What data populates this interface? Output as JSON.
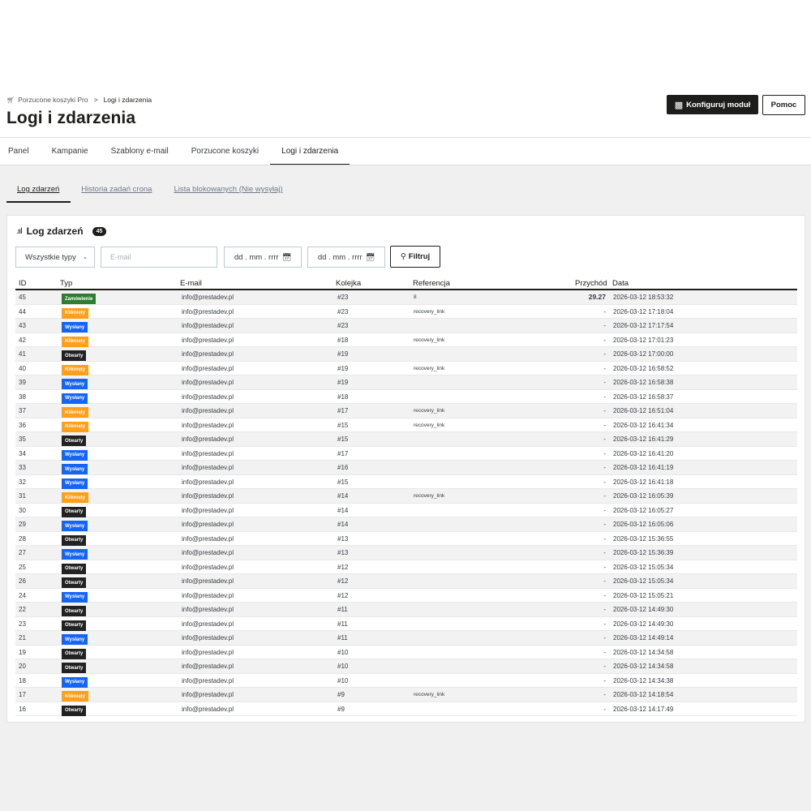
{
  "colors": {
    "zamowienie": "#2e7d32",
    "klikniety": "#ff9f1a",
    "wyslany": "#1565f5",
    "otwarty": "#222222",
    "primary": "#1d1d1b"
  },
  "breadcrumb": {
    "icon": "cart-icon",
    "parent": "Porzucone koszyki Pro",
    "separator": ">",
    "current": "Logi i zdarzenia"
  },
  "page_title": "Logi i zdarzenia",
  "header_buttons": {
    "configure": "Konfiguruj moduł",
    "help": "Pomoc"
  },
  "tabs": [
    "Panel",
    "Kampanie",
    "Szablony e-mail",
    "Porzucone koszyki",
    "Logi i zdarzenia"
  ],
  "active_tab": "Logi i zdarzenia",
  "subtabs": [
    "Log zdarzeń",
    "Historia zadań crona",
    "Lista blokowanych (Nie wysyłaj)"
  ],
  "card": {
    "title": "Log zdarzeń",
    "count": "45"
  },
  "filters": {
    "type_select": "Wszystkie typy",
    "email_placeholder": "E-mail",
    "date_from": "dd . mm . rrrr",
    "date_to": "dd . mm . rrrr",
    "filter_button": "Filtruj"
  },
  "columns": {
    "id": "ID",
    "typ": "Typ",
    "email": "E-mail",
    "kolejka": "Kolejka",
    "referencja": "Referencja",
    "przychod": "Przychód",
    "data": "Data"
  },
  "rows": [
    {
      "id": "45",
      "type": "Zamówienie",
      "kind": "zamowienie",
      "email": "info@prestadev.pl",
      "queue": "#23",
      "ref": "8",
      "revenue": "29.27",
      "date": "2026-03-12 18:53:32"
    },
    {
      "id": "44",
      "type": "Kliknięty",
      "kind": "klikniety",
      "email": "info@prestadev.pl",
      "queue": "#23",
      "ref": "recovery_link",
      "revenue": "-",
      "date": "2026-03-12 17:18:04"
    },
    {
      "id": "43",
      "type": "Wysłany",
      "kind": "wyslany",
      "email": "info@prestadev.pl",
      "queue": "#23",
      "ref": "",
      "revenue": "-",
      "date": "2026-03-12 17:17:54"
    },
    {
      "id": "42",
      "type": "Kliknięty",
      "kind": "klikniety",
      "email": "info@prestadev.pl",
      "queue": "#18",
      "ref": "recovery_link",
      "revenue": "-",
      "date": "2026-03-12 17:01:23"
    },
    {
      "id": "41",
      "type": "Otwarty",
      "kind": "otwarty",
      "email": "info@prestadev.pl",
      "queue": "#19",
      "ref": "",
      "revenue": "-",
      "date": "2026-03-12 17:00:00"
    },
    {
      "id": "40",
      "type": "Kliknięty",
      "kind": "klikniety",
      "email": "info@prestadev.pl",
      "queue": "#19",
      "ref": "recovery_link",
      "revenue": "-",
      "date": "2026-03-12 16:58:52"
    },
    {
      "id": "39",
      "type": "Wysłany",
      "kind": "wyslany",
      "email": "info@prestadev.pl",
      "queue": "#19",
      "ref": "",
      "revenue": "-",
      "date": "2026-03-12 16:58:38"
    },
    {
      "id": "38",
      "type": "Wysłany",
      "kind": "wyslany",
      "email": "info@prestadev.pl",
      "queue": "#18",
      "ref": "",
      "revenue": "-",
      "date": "2026-03-12 16:58:37"
    },
    {
      "id": "37",
      "type": "Kliknięty",
      "kind": "klikniety",
      "email": "info@prestadev.pl",
      "queue": "#17",
      "ref": "recovery_link",
      "revenue": "-",
      "date": "2026-03-12 16:51:04"
    },
    {
      "id": "36",
      "type": "Kliknięty",
      "kind": "klikniety",
      "email": "info@prestadev.pl",
      "queue": "#15",
      "ref": "recovery_link",
      "revenue": "-",
      "date": "2026-03-12 16:41:34"
    },
    {
      "id": "35",
      "type": "Otwarty",
      "kind": "otwarty",
      "email": "info@prestadev.pl",
      "queue": "#15",
      "ref": "",
      "revenue": "-",
      "date": "2026-03-12 16:41:29"
    },
    {
      "id": "34",
      "type": "Wysłany",
      "kind": "wyslany",
      "email": "info@prestadev.pl",
      "queue": "#17",
      "ref": "",
      "revenue": "-",
      "date": "2026-03-12 16:41:20"
    },
    {
      "id": "33",
      "type": "Wysłany",
      "kind": "wyslany",
      "email": "info@prestadev.pl",
      "queue": "#16",
      "ref": "",
      "revenue": "-",
      "date": "2026-03-12 16:41:19"
    },
    {
      "id": "32",
      "type": "Wysłany",
      "kind": "wyslany",
      "email": "info@prestadev.pl",
      "queue": "#15",
      "ref": "",
      "revenue": "-",
      "date": "2026-03-12 16:41:18"
    },
    {
      "id": "31",
      "type": "Kliknięty",
      "kind": "klikniety",
      "email": "info@prestadev.pl",
      "queue": "#14",
      "ref": "recovery_link",
      "revenue": "-",
      "date": "2026-03-12 16:05:39"
    },
    {
      "id": "30",
      "type": "Otwarty",
      "kind": "otwarty",
      "email": "info@prestadev.pl",
      "queue": "#14",
      "ref": "",
      "revenue": "-",
      "date": "2026-03-12 16:05:27"
    },
    {
      "id": "29",
      "type": "Wysłany",
      "kind": "wyslany",
      "email": "info@prestadev.pl",
      "queue": "#14",
      "ref": "",
      "revenue": "-",
      "date": "2026-03-12 16:05:06"
    },
    {
      "id": "28",
      "type": "Otwarty",
      "kind": "otwarty",
      "email": "info@prestadev.pl",
      "queue": "#13",
      "ref": "",
      "revenue": "-",
      "date": "2026-03-12 15:36:55"
    },
    {
      "id": "27",
      "type": "Wysłany",
      "kind": "wyslany",
      "email": "info@prestadev.pl",
      "queue": "#13",
      "ref": "",
      "revenue": "-",
      "date": "2026-03-12 15:36:39"
    },
    {
      "id": "25",
      "type": "Otwarty",
      "kind": "otwarty",
      "email": "info@prestadev.pl",
      "queue": "#12",
      "ref": "",
      "revenue": "-",
      "date": "2026-03-12 15:05:34"
    },
    {
      "id": "26",
      "type": "Otwarty",
      "kind": "otwarty",
      "email": "info@prestadev.pl",
      "queue": "#12",
      "ref": "",
      "revenue": "-",
      "date": "2026-03-12 15:05:34"
    },
    {
      "id": "24",
      "type": "Wysłany",
      "kind": "wyslany",
      "email": "info@prestadev.pl",
      "queue": "#12",
      "ref": "",
      "revenue": "-",
      "date": "2026-03-12 15:05:21"
    },
    {
      "id": "22",
      "type": "Otwarty",
      "kind": "otwarty",
      "email": "info@prestadev.pl",
      "queue": "#11",
      "ref": "",
      "revenue": "-",
      "date": "2026-03-12 14:49:30"
    },
    {
      "id": "23",
      "type": "Otwarty",
      "kind": "otwarty",
      "email": "info@prestadev.pl",
      "queue": "#11",
      "ref": "",
      "revenue": "-",
      "date": "2026-03-12 14:49:30"
    },
    {
      "id": "21",
      "type": "Wysłany",
      "kind": "wyslany",
      "email": "info@prestadev.pl",
      "queue": "#11",
      "ref": "",
      "revenue": "-",
      "date": "2026-03-12 14:49:14"
    },
    {
      "id": "19",
      "type": "Otwarty",
      "kind": "otwarty",
      "email": "info@prestadev.pl",
      "queue": "#10",
      "ref": "",
      "revenue": "-",
      "date": "2026-03-12 14:34:58"
    },
    {
      "id": "20",
      "type": "Otwarty",
      "kind": "otwarty",
      "email": "info@prestadev.pl",
      "queue": "#10",
      "ref": "",
      "revenue": "-",
      "date": "2026-03-12 14:34:58"
    },
    {
      "id": "18",
      "type": "Wysłany",
      "kind": "wyslany",
      "email": "info@prestadev.pl",
      "queue": "#10",
      "ref": "",
      "revenue": "-",
      "date": "2026-03-12 14:34:38"
    },
    {
      "id": "17",
      "type": "Kliknięty",
      "kind": "klikniety",
      "email": "info@prestadev.pl",
      "queue": "#9",
      "ref": "recovery_link",
      "revenue": "-",
      "date": "2026-03-12 14:18:54"
    },
    {
      "id": "16",
      "type": "Otwarty",
      "kind": "otwarty",
      "email": "info@prestadev.pl",
      "queue": "#9",
      "ref": "",
      "revenue": "-",
      "date": "2026-03-12 14:17:49"
    }
  ]
}
